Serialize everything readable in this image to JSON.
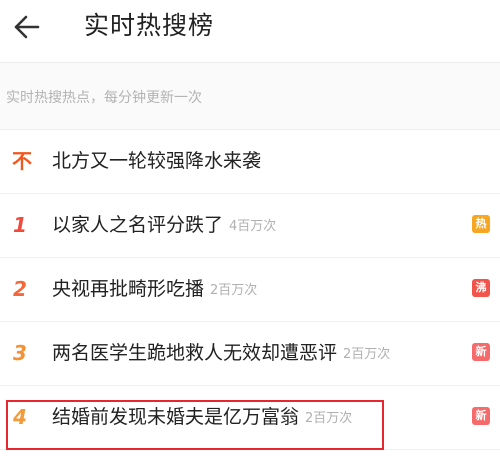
{
  "header": {
    "title": "实时热搜榜",
    "back_icon": "arrow-left-icon"
  },
  "subtitle": "实时热搜热点，每分钟更新一次",
  "colors": {
    "rank_top": "#f2581d",
    "rank_1": "#f04a3d",
    "rank_2": "#f3683a",
    "rank_3": "#f39135",
    "rank_4": "#f39a3a",
    "badge_hot": "#f6a623",
    "badge_boil": "#f0544a",
    "badge_new": "#f56b6b",
    "highlight": "#e8262d"
  },
  "items": [
    {
      "rank": "不",
      "rank_icon": "pinned-top-icon",
      "title": "北方又一轮较强降水来袭",
      "count": "",
      "badge": ""
    },
    {
      "rank": "1",
      "title": "以家人之名评分跌了",
      "count": "4百万次",
      "badge": "热"
    },
    {
      "rank": "2",
      "title": "央视再批畸形吃播",
      "count": "2百万次",
      "badge": "沸"
    },
    {
      "rank": "3",
      "title": "两名医学生跪地救人无效却遭恶评",
      "count": "2百万次",
      "badge": "新"
    },
    {
      "rank": "4",
      "title": "结婚前发现未婚夫是亿万富翁",
      "count": "2百万次",
      "badge": "新"
    }
  ]
}
